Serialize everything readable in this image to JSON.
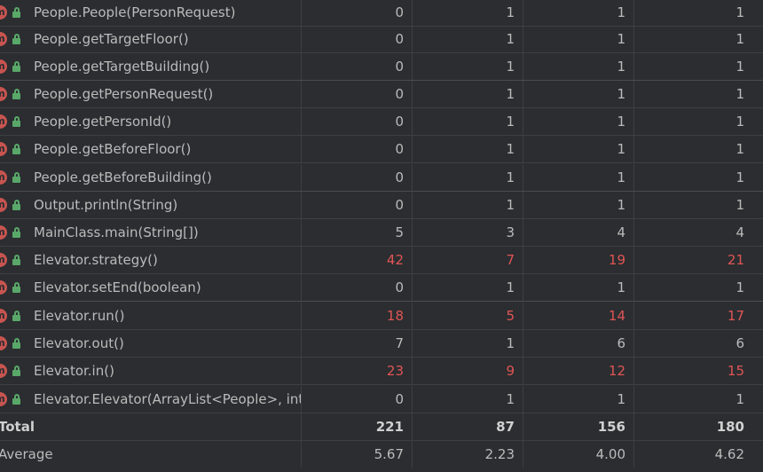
{
  "rows": [
    {
      "name": "People.People(PersonRequest)",
      "v": [
        "0",
        "1",
        "1",
        "1"
      ],
      "red": false
    },
    {
      "name": "People.getTargetFloor()",
      "v": [
        "0",
        "1",
        "1",
        "1"
      ],
      "red": false
    },
    {
      "name": "People.getTargetBuilding()",
      "v": [
        "0",
        "1",
        "1",
        "1"
      ],
      "red": false
    },
    {
      "name": "People.getPersonRequest()",
      "v": [
        "0",
        "1",
        "1",
        "1"
      ],
      "red": false
    },
    {
      "name": "People.getPersonId()",
      "v": [
        "0",
        "1",
        "1",
        "1"
      ],
      "red": false
    },
    {
      "name": "People.getBeforeFloor()",
      "v": [
        "0",
        "1",
        "1",
        "1"
      ],
      "red": false
    },
    {
      "name": "People.getBeforeBuilding()",
      "v": [
        "0",
        "1",
        "1",
        "1"
      ],
      "red": false
    },
    {
      "name": "Output.println(String)",
      "v": [
        "0",
        "1",
        "1",
        "1"
      ],
      "red": false
    },
    {
      "name": "MainClass.main(String[])",
      "v": [
        "5",
        "3",
        "4",
        "4"
      ],
      "red": false
    },
    {
      "name": "Elevator.strategy()",
      "v": [
        "42",
        "7",
        "19",
        "21"
      ],
      "red": true
    },
    {
      "name": "Elevator.setEnd(boolean)",
      "v": [
        "0",
        "1",
        "1",
        "1"
      ],
      "red": false
    },
    {
      "name": "Elevator.run()",
      "v": [
        "18",
        "5",
        "14",
        "17"
      ],
      "red": true
    },
    {
      "name": "Elevator.out()",
      "v": [
        "7",
        "1",
        "6",
        "6"
      ],
      "red": false
    },
    {
      "name": "Elevator.in()",
      "v": [
        "23",
        "9",
        "12",
        "15"
      ],
      "red": true
    },
    {
      "name": "Elevator.Elevator(ArrayList<People>, int, c",
      "v": [
        "0",
        "1",
        "1",
        "1"
      ],
      "red": false
    }
  ],
  "total": {
    "label": "Total",
    "v": [
      "221",
      "87",
      "156",
      "180"
    ]
  },
  "average": {
    "label": "Average",
    "v": [
      "5.67",
      "2.23",
      "4.00",
      "4.62"
    ]
  },
  "icons": {
    "method": "method-icon",
    "access": "unlocked-public-icon"
  },
  "colors": {
    "background": "#2b2d30",
    "text": "#bbbbbb",
    "highlight": "#e05555",
    "method_icon": "#c75450",
    "lock_icon": "#59a869"
  }
}
